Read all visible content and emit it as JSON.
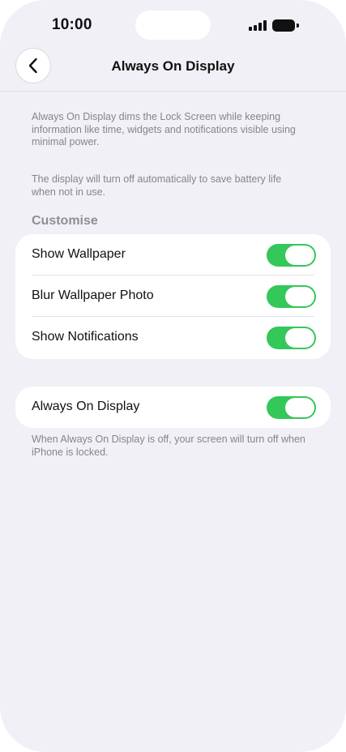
{
  "status_bar": {
    "time": "10:00",
    "signal_icon": "cellular-signal-icon",
    "battery_icon": "battery-icon"
  },
  "nav": {
    "back_icon": "chevron-left-icon",
    "title": "Always On Display"
  },
  "intro": {
    "description_1": "Always On Display dims the Lock Screen while keeping information like time, widgets and notifications visible using minimal power.",
    "description_2": "The display will turn off automatically to save battery life when not in use."
  },
  "customise": {
    "header": "Customise",
    "items": [
      {
        "label": "Show Wallpaper",
        "enabled": true
      },
      {
        "label": "Blur Wallpaper Photo",
        "enabled": true
      },
      {
        "label": "Show Notifications",
        "enabled": true
      }
    ]
  },
  "always_on": {
    "label": "Always On Display",
    "enabled": true,
    "footer": "When Always On Display is off, your screen will turn off when iPhone is locked."
  },
  "colors": {
    "toggle_on": "#34c759",
    "background": "#f1f0f6",
    "card": "#ffffff"
  }
}
